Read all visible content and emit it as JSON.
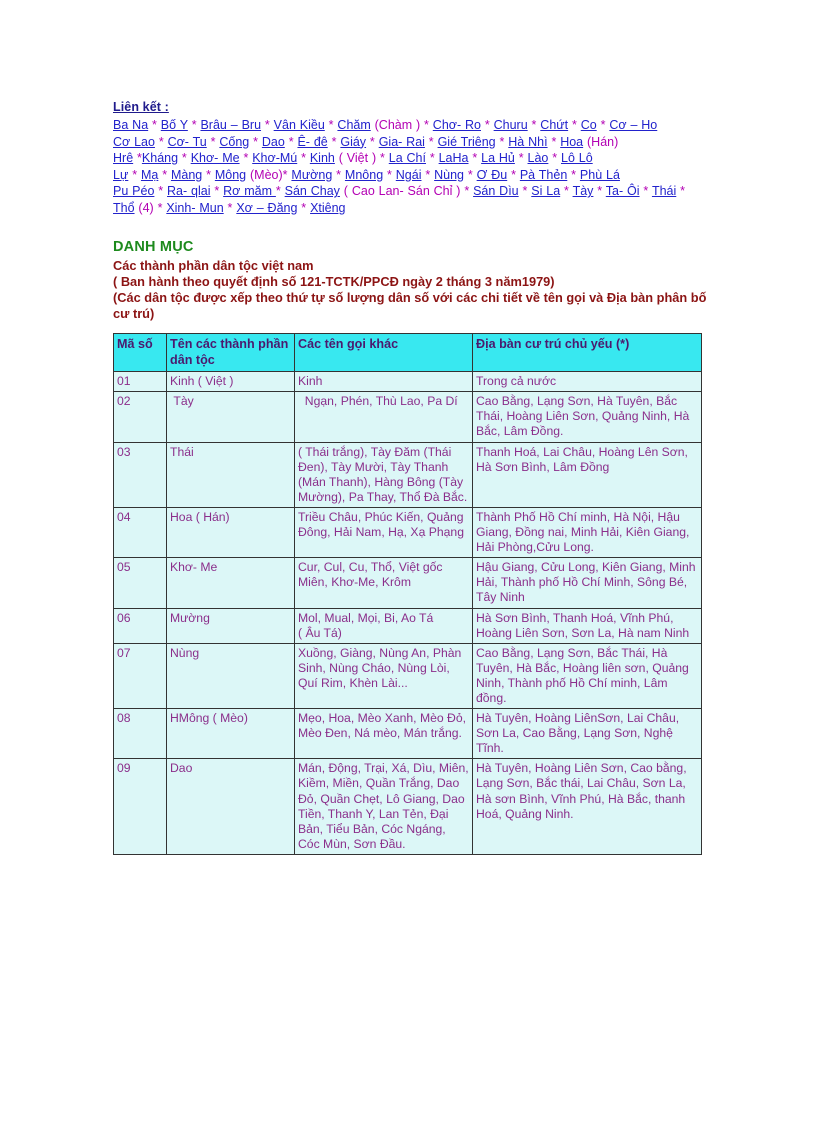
{
  "links_section": {
    "heading": "Liên kết :",
    "lines": [
      {
        "tokens": [
          {
            "t": "link",
            "text": "Ba Na"
          },
          {
            "t": "sep",
            "text": " * "
          },
          {
            "t": "link",
            "text": "Bố Y"
          },
          {
            "t": "sep",
            "text": " * "
          },
          {
            "t": "link",
            "text": "Brâu – Bru"
          },
          {
            "t": "sep",
            "text": " * "
          },
          {
            "t": "link",
            "text": "Vân Kiều"
          },
          {
            "t": "sep",
            "text": " * "
          },
          {
            "t": "link",
            "text": "Chăm"
          },
          {
            "t": "plain",
            "text": " (Chàm ) * "
          },
          {
            "t": "link",
            "text": "Chơ- Ro"
          },
          {
            "t": "sep",
            "text": " * "
          },
          {
            "t": "link",
            "text": "Churu"
          },
          {
            "t": "sep",
            "text": " * "
          },
          {
            "t": "link",
            "text": "Chứt"
          },
          {
            "t": "sep",
            "text": " *  "
          },
          {
            "t": "link",
            "text": "Co"
          },
          {
            "t": "sep",
            "text": " * "
          },
          {
            "t": "link",
            "text": "Cơ – Ho"
          }
        ]
      },
      {
        "tokens": [
          {
            "t": "link",
            "text": "Cơ Lao"
          },
          {
            "t": "sep",
            "text": " * "
          },
          {
            "t": "link",
            "text": "Cơ- Tu"
          },
          {
            "t": "sep",
            "text": " * "
          },
          {
            "t": "link",
            "text": "Cống"
          },
          {
            "t": "sep",
            "text": " * "
          },
          {
            "t": "link",
            "text": "Dao"
          },
          {
            "t": "sep",
            "text": " * "
          },
          {
            "t": "link",
            "text": "Ê- đê"
          },
          {
            "t": "sep",
            "text": " *  "
          },
          {
            "t": "link",
            "text": "Giáy"
          },
          {
            "t": "sep",
            "text": " * "
          },
          {
            "t": "link",
            "text": "Gia- Rai"
          },
          {
            "t": "sep",
            "text": " * "
          },
          {
            "t": "link",
            "text": "Gié Triêng"
          },
          {
            "t": "sep",
            "text": " * "
          },
          {
            "t": "link",
            "text": "Hà Nhì"
          },
          {
            "t": "sep",
            "text": " * "
          },
          {
            "t": "link",
            "text": "Hoa"
          },
          {
            "t": "plain",
            "text": " (Hán)"
          }
        ]
      },
      {
        "tokens": [
          {
            "t": "link",
            "text": "Hrê"
          },
          {
            "t": "sep",
            "text": " *"
          },
          {
            "t": "link",
            "text": "Kháng"
          },
          {
            "t": "sep",
            "text": " * "
          },
          {
            "t": "link",
            "text": "Khơ- Me"
          },
          {
            "t": "sep",
            "text": " * "
          },
          {
            "t": "link",
            "text": "Khơ-Mú"
          },
          {
            "t": "sep",
            "text": " * "
          },
          {
            "t": "link",
            "text": "Kinh"
          },
          {
            "t": "plain",
            "text": " ( Việt ) * "
          },
          {
            "t": "link",
            "text": "La Chí"
          },
          {
            "t": "sep",
            "text": " * "
          },
          {
            "t": "link",
            "text": "LaHa"
          },
          {
            "t": "sep",
            "text": " * "
          },
          {
            "t": "link",
            "text": "La Hủ"
          },
          {
            "t": "sep",
            "text": " * "
          },
          {
            "t": "link",
            "text": "Lào"
          },
          {
            "t": "sep",
            "text": " * "
          },
          {
            "t": "link",
            "text": "Lô Lô"
          }
        ]
      },
      {
        "tokens": [
          {
            "t": "link",
            "text": "Lự"
          },
          {
            "t": "sep",
            "text": " * "
          },
          {
            "t": "link",
            "text": "Mạ"
          },
          {
            "t": "sep",
            "text": " *  "
          },
          {
            "t": "link",
            "text": "Màng"
          },
          {
            "t": "sep",
            "text": " * "
          },
          {
            "t": "link",
            "text": "Mông"
          },
          {
            "t": "plain",
            "text": " (Mèo)"
          },
          {
            "t": "sep",
            "text": "* "
          },
          {
            "t": "link",
            "text": "Mường"
          },
          {
            "t": "sep",
            "text": " * "
          },
          {
            "t": "link",
            "text": "Mnông"
          },
          {
            "t": "sep",
            "text": " * "
          },
          {
            "t": "link",
            "text": "Ngái"
          },
          {
            "t": "sep",
            "text": " * "
          },
          {
            "t": "link",
            "text": "Nùng"
          },
          {
            "t": "sep",
            "text": " * "
          },
          {
            "t": "link",
            "text": "Ơ Đu"
          },
          {
            "t": "sep",
            "text": " * "
          },
          {
            "t": "link",
            "text": "Pà Thẻn"
          },
          {
            "t": "sep",
            "text": " * "
          },
          {
            "t": "link",
            "text": "Phù Lá"
          }
        ]
      },
      {
        "tokens": [
          {
            "t": "link",
            "text": "Pu Péo"
          },
          {
            "t": "sep",
            "text": " * "
          },
          {
            "t": "link",
            "text": "Ra- qlai"
          },
          {
            "t": "sep",
            "text": " *  "
          },
          {
            "t": "link",
            "text": "Rơ măm "
          },
          {
            "t": "sep",
            "text": " * "
          },
          {
            "t": "link",
            "text": "Sán Chay"
          },
          {
            "t": "plain",
            "text": " ( Cao Lan- Sán Chỉ ) * "
          },
          {
            "t": "link",
            "text": "Sán Dìu"
          },
          {
            "t": "sep",
            "text": " * "
          },
          {
            "t": "link",
            "text": "Si La"
          },
          {
            "t": "sep",
            "text": " * "
          },
          {
            "t": "link",
            "text": "Tày"
          },
          {
            "t": "sep",
            "text": " * "
          },
          {
            "t": "link",
            "text": "Ta- Ôi"
          },
          {
            "t": "sep",
            "text": " * "
          },
          {
            "t": "link",
            "text": "Thái"
          },
          {
            "t": "sep",
            "text": " * "
          }
        ]
      },
      {
        "tokens": [
          {
            "t": "link",
            "text": "Thổ"
          },
          {
            "t": "plain",
            "text": " (4) * "
          },
          {
            "t": "link",
            "text": "Xinh- Mun"
          },
          {
            "t": "sep",
            "text": " * "
          },
          {
            "t": "link",
            "text": "Xơ – Đăng"
          },
          {
            "t": "sep",
            "text": " * "
          },
          {
            "t": "link",
            "text": "Xtiêng"
          }
        ]
      }
    ]
  },
  "catalog": {
    "title": "DANH MỤC",
    "subtitle_lines": [
      "Các thành phần dân tộc việt nam",
      "( Ban hành theo quyết định số 121-TCTK/PPCĐ   ngày 2 tháng 3 năm1979)",
      "(Các dân tộc được xếp theo thứ tự số lượng  dân số với các chi tiết về tên gọi và Địa bàn phân bố cư trú)"
    ]
  },
  "table": {
    "headers": [
      "Mã số",
      "Tên các thành phần dân tộc",
      "Các tên gọi khác",
      "Địa bàn cư trú chủ yếu (*)"
    ],
    "rows": [
      {
        "ma_so": "01",
        "ten": "Kinh ( Việt )",
        "ten_khac": "Kinh",
        "dia_ban": "Trong cả nước"
      },
      {
        "ma_so": "02",
        "ten": " Tày",
        "ten_khac": "  Ngạn, Phén, Thù Lao, Pa Dí",
        "dia_ban": "Cao Bằng, Lạng Sơn, Hà Tuyên, Bắc Thái, Hoàng Liên Sơn, Quảng Ninh, Hà Bắc, Lâm Đồng."
      },
      {
        "ma_so": "03",
        "ten": "Thái",
        "ten_khac": "( Thái trắng), Tày Đăm (Thái Đen), Tày Mười, Tày Thanh (Mán Thanh), Hàng Bông (Tày Mường), Pa Thay, Thổ Đà Bắc.",
        "dia_ban": "Thanh Hoá, Lai Châu, Hoàng Lên Sơn, Hà Sơn Bình, Lâm Đồng"
      },
      {
        "ma_so": "04",
        "ten": "Hoa ( Hán)",
        "ten_khac": "Triều Châu, Phúc Kiến, Quảng Đông, Hải Nam, Hạ, Xạ Phạng",
        "dia_ban": "Thành Phố Hồ Chí minh, Hà Nội, Hậu Giang, Đồng nai, Minh Hải, Kiên Giang, Hải Phòng,Cửu Long."
      },
      {
        "ma_so": "05",
        "ten": "Khơ- Me",
        "ten_khac": "Cur, Cul, Cu, Thổ, Việt gốc Miên, Khơ-Me, Krôm",
        "dia_ban": "Hậu Giang, Cửu Long, Kiên Giang, Minh Hải, Thành phố Hồ Chí Minh, Sông Bé, Tây Ninh"
      },
      {
        "ma_so": "06",
        "ten": "Mường",
        "ten_khac": "Mol, Mual, Mọi, Bi, Ao Tá              ( Âu Tá)",
        "dia_ban": "Hà Sơn Bình, Thanh Hoá, Vĩnh Phú, Hoàng Liên Sơn, Sơn La, Hà nam Ninh"
      },
      {
        "ma_so": "07",
        "ten": "Nùng",
        "ten_khac": "Xuồng, Giàng, Nùng An, Phàn Sinh, Nùng Cháo, Nùng Lòi, Quí Rim, Khèn Lài...",
        "dia_ban": "Cao Bằng, Lạng Sơn, Bắc Thái, Hà Tuyên, Hà Bắc, Hoàng liên sơn, Quảng Ninh, Thành phố Hồ Chí minh, Lâm đồng."
      },
      {
        "ma_so": "08",
        "ten": "HMông ( Mèo)",
        "ten_khac": "Mẹo, Hoa, Mèo Xanh, Mèo Đỏ, Mèo Đen, Ná mèo, Mán trắng.",
        "dia_ban": "Hà Tuyên, Hoàng LiênSơn, Lai Châu, Sơn La, Cao Bằng, Lạng Sơn, Nghệ Tĩnh."
      },
      {
        "ma_so": "09",
        "ten": "Dao",
        "ten_khac": "Mán, Động, Trại, Xá, Dìu, Miên, Kiềm, Miền, Quần Trắng, Dao Đỏ, Quần Chẹt, Lô Giang, Dao Tiền, Thanh Y, Lan Tẻn, Đại Bản, Tiểu Bản, Cóc Ngáng, Cóc Mùn, Sơn Đầu.",
        "dia_ban": "Hà Tuyên, Hoàng Liên Sơn, Cao bằng, Lạng Sơn, Bắc thái, Lai Châu, Sơn La, Hà sơn Bình, Vĩnh Phú, Hà Bắc, thanh Hoá, Quảng Ninh."
      }
    ]
  },
  "colors": {
    "link": "#2222cc",
    "separator": "#b300b3",
    "links_heading": "#1f1a8c",
    "catalog_title": "#1d8a1d",
    "subtitle": "#8c1414",
    "table_header_bg": "#38e8f0",
    "table_header_text": "#4b1a6e",
    "table_cell_bg": "#dcf7f7",
    "table_cell_text": "#8b2f8b",
    "table_border": "#333333"
  }
}
